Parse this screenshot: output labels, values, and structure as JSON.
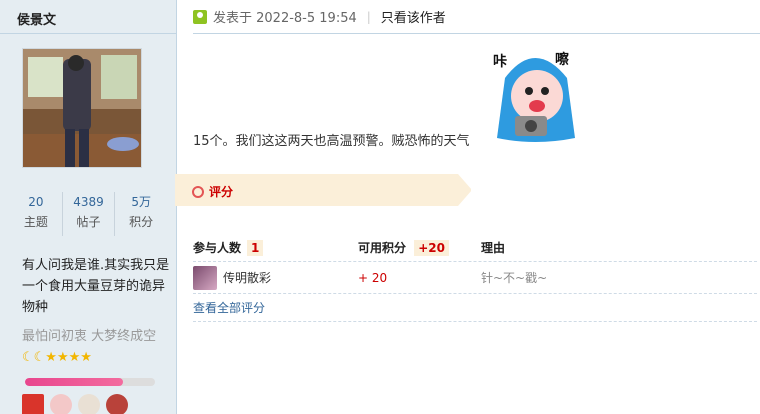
{
  "author": {
    "name": "侯景文",
    "stats": [
      {
        "value": "20",
        "label": "主题"
      },
      {
        "value": "4389",
        "label": "帖子"
      },
      {
        "value": "5万",
        "label": "积分"
      }
    ],
    "signature": "有人问我是谁.其实我只是一个食用大量豆芽的诡异物种",
    "signature2": "最怕问初衷 大梦终成空",
    "level_icons": "☾☾★★★★",
    "level_progress_percent": 75
  },
  "post": {
    "timestamp": "发表于 2022-8-5 19:54",
    "separator": "|",
    "only_author": "只看该作者",
    "content": "15个。我们这这两天也高温预警。贼恐怖的天气"
  },
  "rating": {
    "tab_label": "评分",
    "col_participants": "参与人数",
    "participants_count": "1",
    "col_points": "可用积分",
    "points_total": "+20",
    "col_reason": "理由",
    "rows": [
      {
        "name": "传明散彩",
        "points": "+ 20",
        "reason": "针~不~戳~"
      }
    ],
    "view_all": "查看全部评分"
  },
  "colors": {
    "sidebar_bg": "#e5edf2",
    "border": "#c2d5e3",
    "accent_red": "#cc0000",
    "link_blue": "#336699"
  }
}
